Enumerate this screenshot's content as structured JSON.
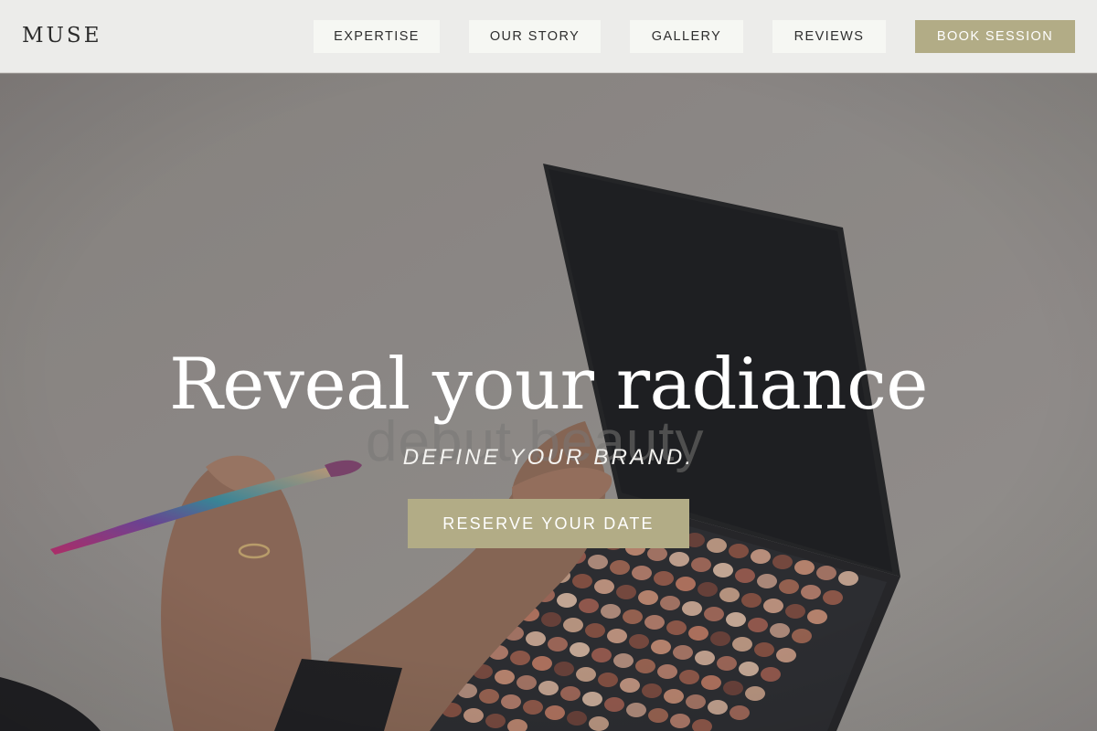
{
  "brand": {
    "name": "MUSE"
  },
  "nav": {
    "items": [
      {
        "label": "EXPERTISE"
      },
      {
        "label": "OUR STORY"
      },
      {
        "label": "GALLERY"
      },
      {
        "label": "REVIEWS"
      }
    ],
    "cta_label": "BOOK SESSION"
  },
  "hero": {
    "title": "Reveal your radiance",
    "background_text": "debut beauty",
    "subtitle": "DEFINE YOUR BRAND.",
    "cta_label": "RESERVE YOUR DATE"
  },
  "colors": {
    "accent": "#b2ac86",
    "nav_background": "#ececea",
    "nav_button": "#f6f7f3",
    "hero_overlay": "#8f8b87"
  },
  "icons": [
    "eyeshadow-palette-image",
    "makeup-brush-image"
  ]
}
